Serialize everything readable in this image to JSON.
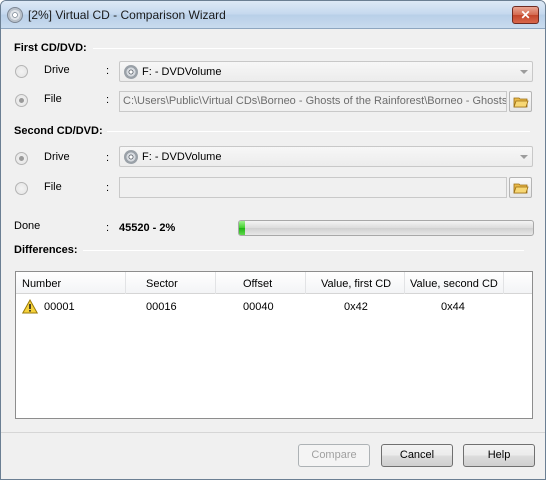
{
  "window": {
    "title": "[2%] Virtual CD - Comparison Wizard",
    "close_glyph": "✕"
  },
  "first": {
    "title": "First CD/DVD:",
    "drive_label": "Drive",
    "file_label": "File",
    "colon": ":",
    "drive_value": "F: - DVDVolume",
    "file_value": "C:\\Users\\Public\\Virtual CDs\\Borneo - Ghosts of the Rainforest\\Borneo - Ghosts of the Rainforest",
    "selected": "file"
  },
  "second": {
    "title": "Second CD/DVD:",
    "drive_label": "Drive",
    "file_label": "File",
    "colon": ":",
    "drive_value": "F: - DVDVolume",
    "file_value": "",
    "selected": "drive"
  },
  "progress": {
    "label": "Done",
    "colon": ":",
    "value_text": "45520  - 2%",
    "percent": 2
  },
  "differences": {
    "title": "Differences:",
    "columns": [
      "Number",
      "Sector",
      "Offset",
      "Value, first CD",
      "Value, second CD"
    ],
    "rows": [
      {
        "number": "00001",
        "sector": "00016",
        "offset": "00040",
        "value_first": "0x42",
        "value_second": "0x44"
      }
    ]
  },
  "buttons": {
    "compare": "Compare",
    "cancel": "Cancel",
    "help": "Help"
  },
  "icons": {
    "app": "cd-icon",
    "drive": "cd-drive-icon",
    "browse": "folder-open-icon",
    "row_status": "warning-icon"
  }
}
